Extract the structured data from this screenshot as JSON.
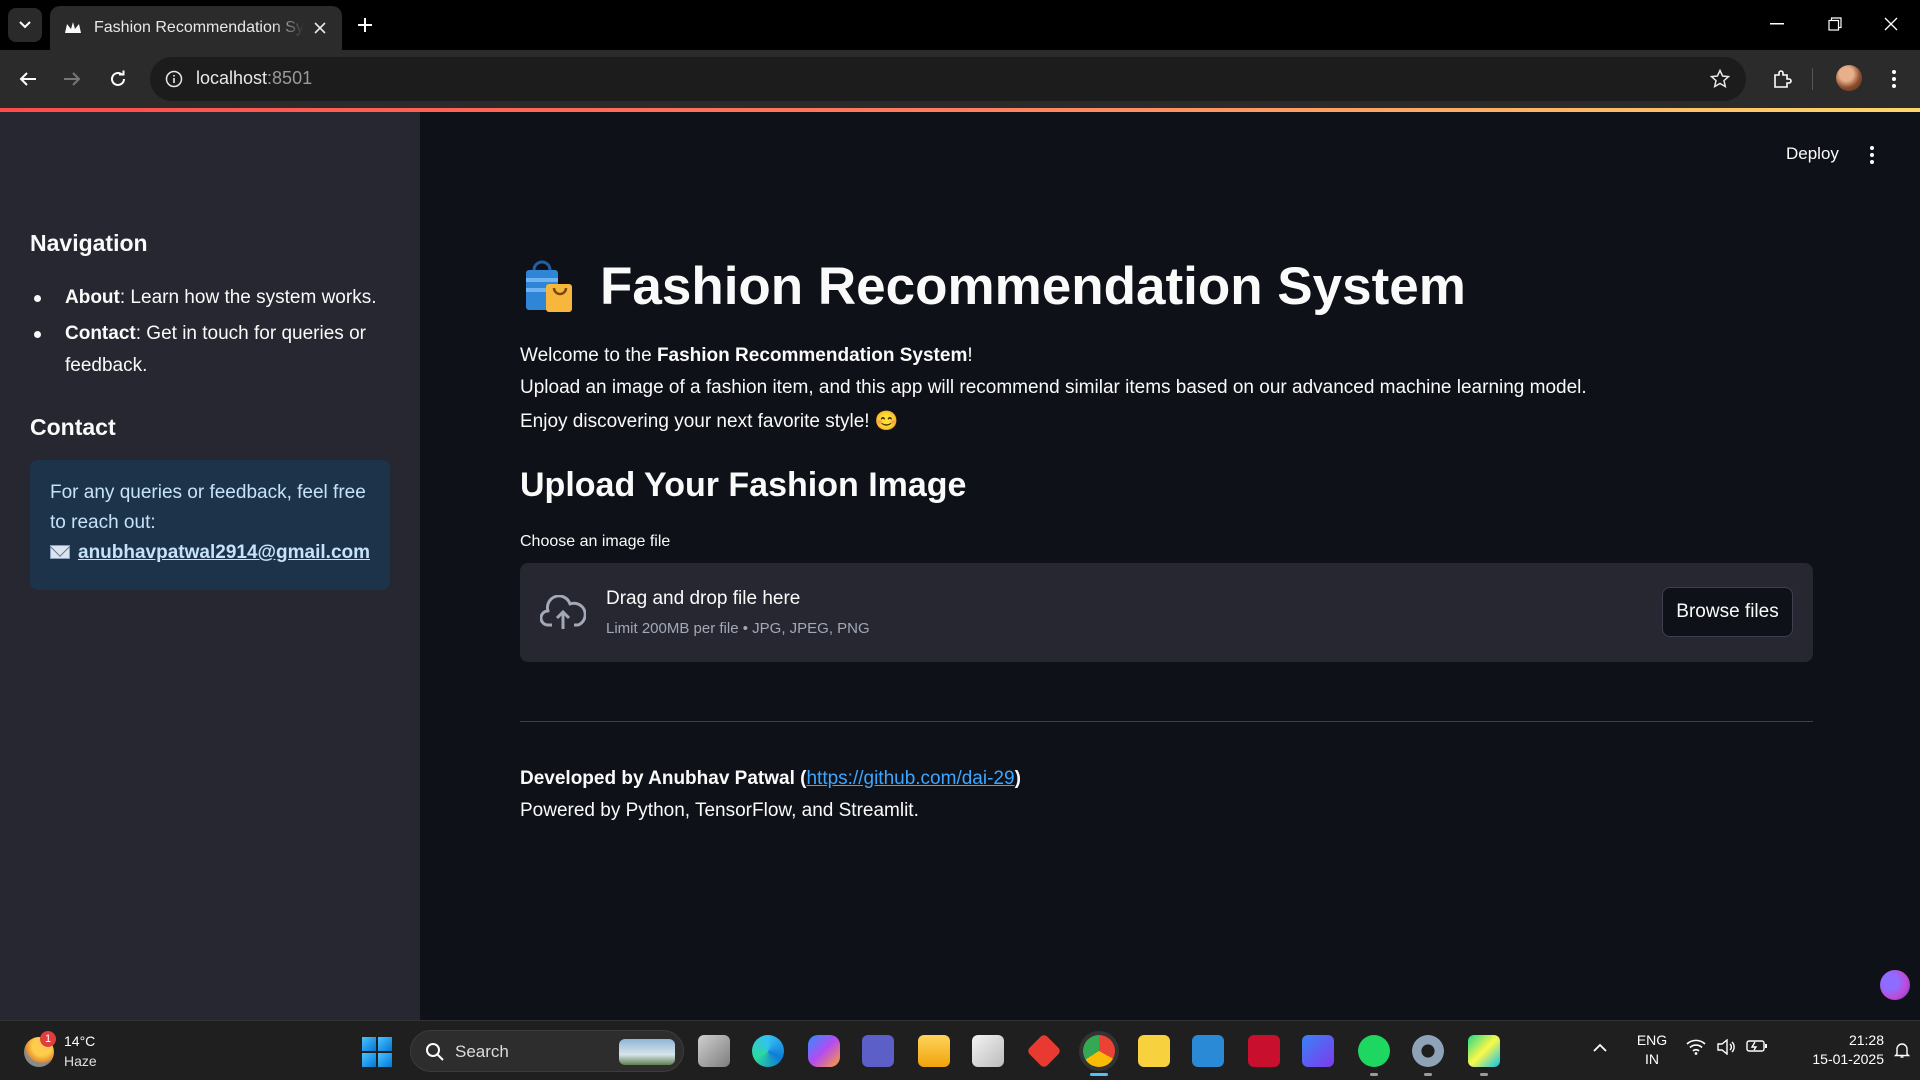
{
  "browser": {
    "tab_title": "Fashion Recommendation System",
    "url_host": "localhost",
    "url_port": ":8501"
  },
  "app": {
    "toolbar": {
      "deploy_label": "Deploy"
    },
    "sidebar": {
      "nav_heading": "Navigation",
      "nav_items": [
        {
          "bold": "About",
          "text": ": Learn how the system works."
        },
        {
          "bold": "Contact",
          "text": ": Get in touch for queries or feedback."
        }
      ],
      "contact_heading": "Contact",
      "contact_text": "For any queries or feedback, feel free to reach out:",
      "contact_email": "anubhavpatwal2914@gmail.com"
    },
    "main": {
      "title": "Fashion Recommendation System",
      "welcome_prefix": "Welcome to the ",
      "welcome_bold": "Fashion Recommendation System",
      "welcome_suffix": "!",
      "intro_line2": "Upload an image of a fashion item, and this app will recommend similar items based on our advanced machine learning model.",
      "intro_line3": "Enjoy discovering your next favorite style! 😊",
      "upload_heading": "Upload Your Fashion Image",
      "uploader": {
        "label": "Choose an image file",
        "drag_text": "Drag and drop file here",
        "limit_text": "Limit 200MB per file • JPG, JPEG, PNG",
        "browse_label": "Browse files"
      },
      "footer": {
        "developed_by": "Developed by Anubhav Patwal",
        "open_paren": " (",
        "github_link": "https://github.com/dai-29",
        "close_paren": ")",
        "powered_by": "Powered by Python, TensorFlow, and Streamlit."
      }
    }
  },
  "taskbar": {
    "weather_badge": "1",
    "temperature": "14°C",
    "condition": "Haze",
    "search_label": "Search",
    "lang_line1": "ENG",
    "lang_line2": "IN",
    "time": "21:28",
    "date": "15-01-2025"
  }
}
